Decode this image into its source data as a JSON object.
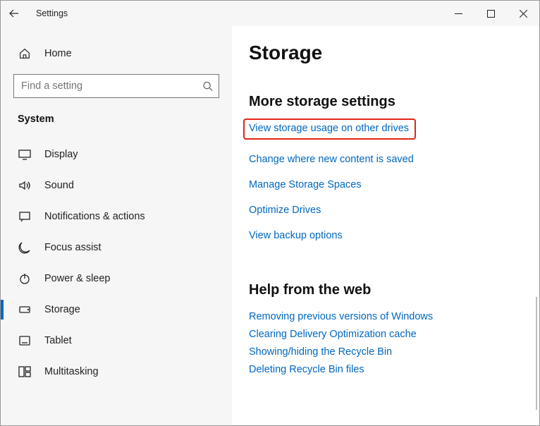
{
  "titlebar": {
    "title": "Settings"
  },
  "sidebar": {
    "home": "Home",
    "searchPlaceholder": "Find a setting",
    "category": "System",
    "items": [
      {
        "label": "Display"
      },
      {
        "label": "Sound"
      },
      {
        "label": "Notifications & actions"
      },
      {
        "label": "Focus assist"
      },
      {
        "label": "Power & sleep"
      },
      {
        "label": "Storage"
      },
      {
        "label": "Tablet"
      },
      {
        "label": "Multitasking"
      }
    ]
  },
  "content": {
    "pageTitle": "Storage",
    "section1": {
      "heading": "More storage settings",
      "links": [
        "View storage usage on other drives",
        "Change where new content is saved",
        "Manage Storage Spaces",
        "Optimize Drives",
        "View backup options"
      ]
    },
    "section2": {
      "heading": "Help from the web",
      "links": [
        "Removing previous versions of Windows",
        "Clearing Delivery Optimization cache",
        "Showing/hiding the Recycle Bin",
        "Deleting Recycle Bin files"
      ]
    }
  }
}
